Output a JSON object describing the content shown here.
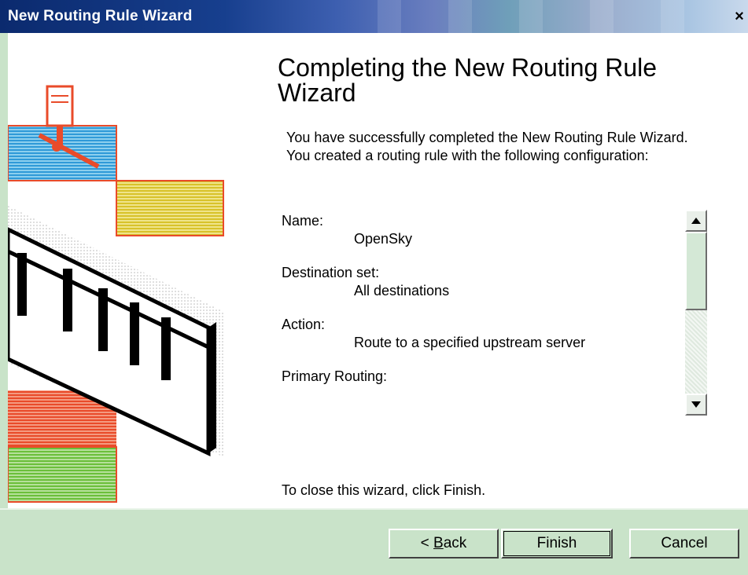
{
  "window": {
    "title": "New Routing Rule Wizard",
    "close_glyph": "×"
  },
  "main": {
    "heading": "Completing the New Routing Rule Wizard",
    "intro": "You have successfully completed the New Routing Rule Wizard. You created a routing rule with the following configuration:",
    "config": [
      {
        "label": "Name:",
        "value": "OpenSky"
      },
      {
        "label": "Destination set:",
        "value": "All destinations"
      },
      {
        "label": "Action:",
        "value": "Route to a specified upstream server"
      },
      {
        "label": "Primary Routing:",
        "value": ""
      }
    ],
    "finish_note": "To close this wizard, click Finish."
  },
  "footer": {
    "back_label_prefix": "< ",
    "back_label_accel": "B",
    "back_label_rest": "ack",
    "finish_label": "Finish",
    "cancel_label": "Cancel"
  },
  "icons": {
    "scroll_up": "up-arrow-icon",
    "scroll_down": "down-arrow-icon",
    "art": "network-firewall-illustration"
  },
  "colors": {
    "accent_green": "#c9e3c9",
    "title_blue": "#0b2a6e"
  }
}
